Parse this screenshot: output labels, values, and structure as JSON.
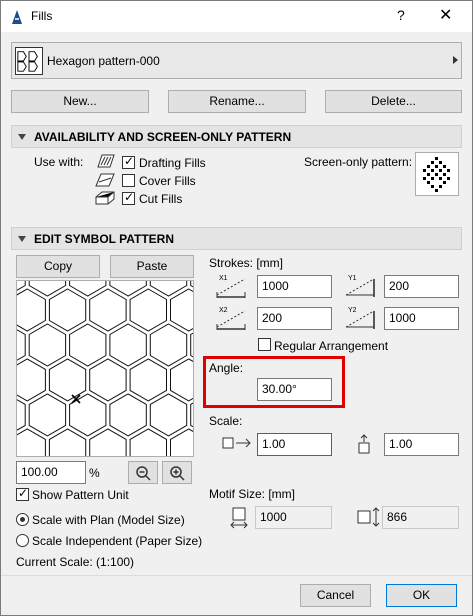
{
  "window": {
    "title": "Fills",
    "help_label": "?",
    "close_label": "✕"
  },
  "pattern_selector": {
    "value": "Hexagon pattern-000"
  },
  "actions": {
    "new_label": "New...",
    "rename_label": "Rename...",
    "delete_label": "Delete..."
  },
  "availability": {
    "header": "AVAILABILITY AND SCREEN-ONLY PATTERN",
    "use_with_label": "Use with:",
    "drafting_label": "Drafting Fills",
    "drafting_checked": true,
    "cover_label": "Cover Fills",
    "cover_checked": false,
    "cut_label": "Cut Fills",
    "cut_checked": true,
    "screen_only_label": "Screen-only pattern:"
  },
  "edit": {
    "header": "EDIT SYMBOL PATTERN",
    "copy_label": "Copy",
    "paste_label": "Paste",
    "zoom_value": "100.00",
    "zoom_unit": "%",
    "strokes_label": "Strokes: [mm]",
    "x1_icon_label": "X1",
    "y1_icon_label": "Y1",
    "x2_icon_label": "X2",
    "y2_icon_label": "Y2",
    "x1": "1000",
    "y1": "200",
    "x2": "200",
    "y2": "1000",
    "regular_label": "Regular Arrangement",
    "regular_checked": false,
    "angle_label": "Angle:",
    "angle_value": "30.00°",
    "scale_label": "Scale:",
    "scale_x": "1.00",
    "scale_y": "1.00",
    "motif_label": "Motif Size: [mm]",
    "motif_w": "1000",
    "motif_h": "866",
    "show_unit_label": "Show Pattern Unit",
    "show_unit_checked": true,
    "scale_plan_label": "Scale with Plan (Model Size)",
    "scale_indep_label": "Scale Independent (Paper Size)",
    "current_scale": "Current Scale: (1:100)"
  },
  "footer": {
    "cancel_label": "Cancel",
    "ok_label": "OK"
  },
  "colors": {
    "highlight": "#e00000",
    "hex_fill": "#ffffc0",
    "focus": "#0078d7"
  }
}
